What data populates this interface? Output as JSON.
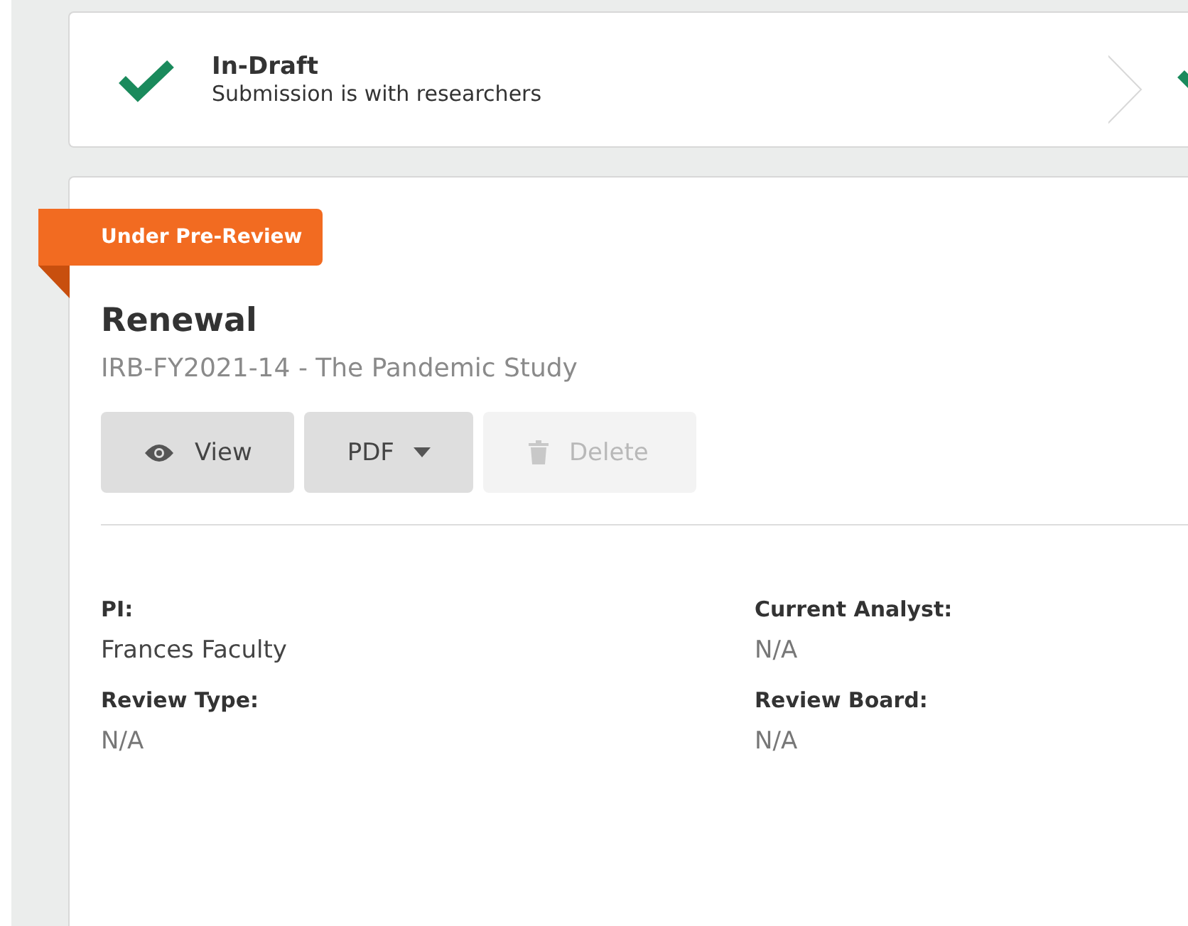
{
  "steps": [
    {
      "title": "In-Draft",
      "subtitle": "Submission is with researchers",
      "done": true
    },
    {
      "done": true
    }
  ],
  "submission": {
    "status_ribbon": "Under Pre-Review",
    "type": "Renewal",
    "study": "IRB-FY2021-14 - The Pandemic Study",
    "buttons": [
      {
        "kind": "view",
        "label": "View",
        "disabled": false
      },
      {
        "kind": "dropdown",
        "label": "PDF",
        "disabled": false
      },
      {
        "kind": "delete",
        "label": "Delete",
        "disabled": true
      }
    ],
    "fields": [
      {
        "label": "PI:",
        "value": "Frances Faculty",
        "muted": false
      },
      {
        "label": "Current Analyst:",
        "value": "N/A",
        "muted": true
      },
      {
        "label": "Review Type:",
        "value": "N/A",
        "muted": true
      },
      {
        "label": "Review Board:",
        "value": "N/A",
        "muted": true
      }
    ]
  }
}
